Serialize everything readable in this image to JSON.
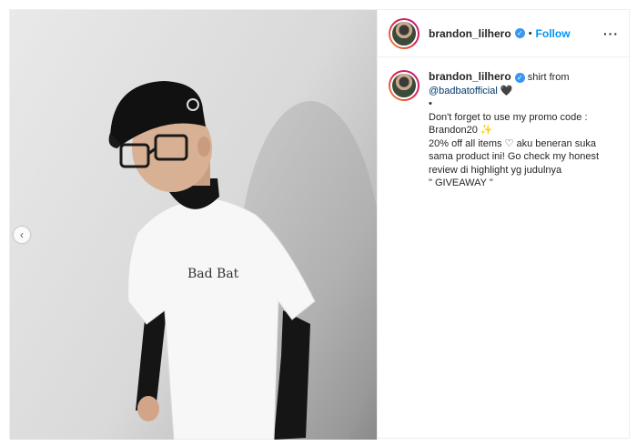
{
  "post": {
    "username": "brandon_lilhero",
    "verified_icon": "verified-badge-icon",
    "separator": "•",
    "follow_label": "Follow",
    "more_label": "···",
    "prev_label": "‹",
    "shirt_text": "Bad Bat"
  },
  "caption": {
    "username": "brandon_lilhero",
    "line1_text": "shirt from",
    "mention": "@badbatofficial",
    "heart1": "🖤",
    "bullet": "•",
    "line3": "Don't forget to use my promo code :",
    "line4": "Brandon20",
    "sparkle": "✨",
    "line5a": "20% off all items",
    "heart2": "♡",
    "line5b": "aku beneran suka sama product ini! Go check my honest review di highlight yg judulnya",
    "line6": "\" GIVEAWAY \""
  },
  "colors": {
    "accent": "#0095f6",
    "verified": "#3897f0",
    "mention": "#00376b",
    "text": "#262626",
    "border": "#efefef"
  }
}
